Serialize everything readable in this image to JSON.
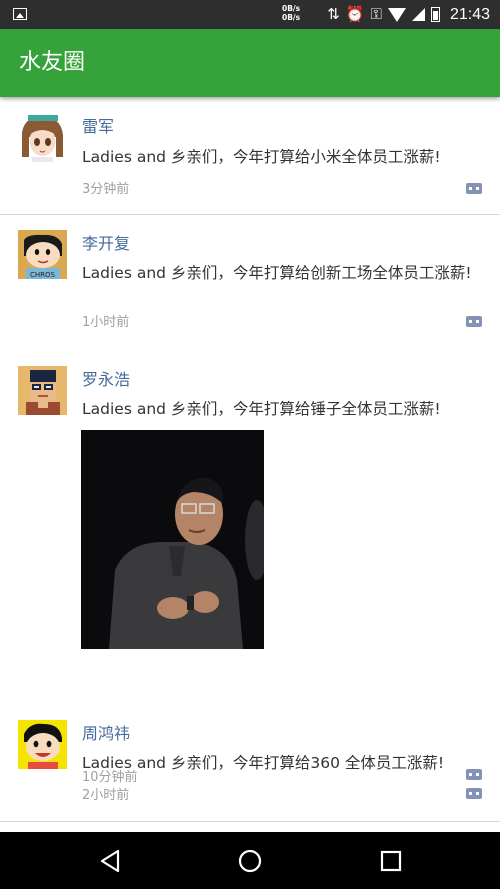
{
  "status_bar": {
    "net_up": "0B/s",
    "net_down": "0B/s",
    "time": "21:43",
    "icons": [
      "image-icon",
      "data-arrows-icon",
      "alarm-icon",
      "key-icon",
      "wifi-icon",
      "signal-icon",
      "battery-icon"
    ]
  },
  "app_bar": {
    "title": "水友圈"
  },
  "posts": [
    {
      "name": "雷军",
      "content": "Ladies and 乡亲们，今年打算给小米全体员工涨薪!",
      "time": "3分钟前",
      "avatar": "anime-girl-avatar"
    },
    {
      "name": "李开复",
      "content": "Ladies and 乡亲们，今年打算给创新工场全体员工涨薪!",
      "time": "1小时前",
      "avatar": "cartoon-boy-avatar"
    },
    {
      "name": "罗永浩",
      "content": "Ladies and 乡亲们，今年打算给锤子全体员工涨薪!",
      "time": "10分钟前",
      "avatar": "pixel-glasses-avatar",
      "has_photo": true
    },
    {
      "name": "周鸿祎",
      "content": "Ladies and 乡亲们，今年打算给360 全体员工涨薪!",
      "time": "2小时前",
      "avatar": "cartoon-yellow-avatar"
    }
  ],
  "nav": {
    "items": [
      "back-icon",
      "home-icon",
      "recents-icon"
    ]
  },
  "colors": {
    "app_bar": "#36a33a",
    "name": "#466a9b",
    "time": "#a0a0a0",
    "comment": "#8492b5"
  }
}
